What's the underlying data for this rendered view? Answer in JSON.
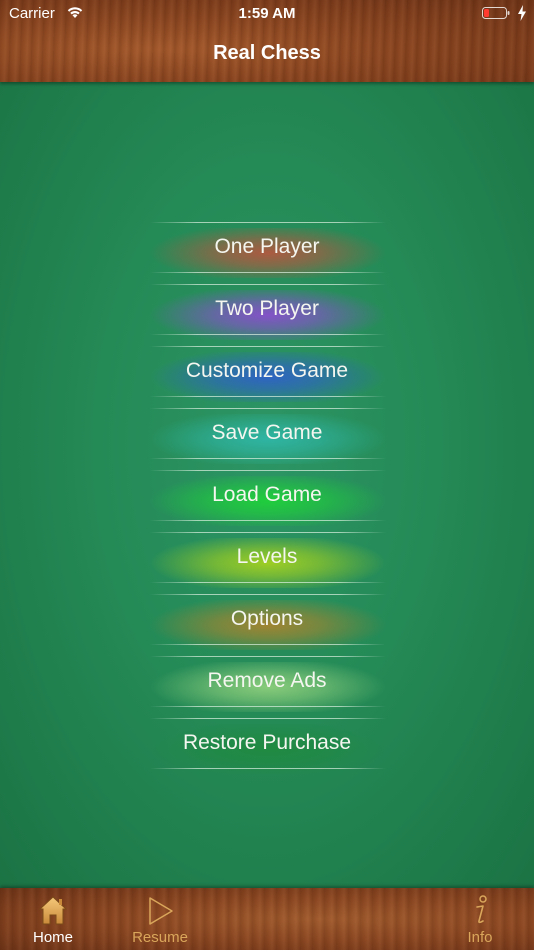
{
  "status_bar": {
    "carrier": "Carrier",
    "time": "1:59 AM",
    "icons": [
      "wifi-icon",
      "battery-low-icon",
      "charging-bolt-icon"
    ]
  },
  "header": {
    "title": "Real Chess"
  },
  "menu": {
    "items": [
      {
        "label": "One Player",
        "glow": "#b5573f"
      },
      {
        "label": "Two Player",
        "glow": "#8a4fcf"
      },
      {
        "label": "Customize Game",
        "glow": "#2f60c9"
      },
      {
        "label": "Save Game",
        "glow": "#2fb7a8"
      },
      {
        "label": "Load Game",
        "glow": "#1fd23a"
      },
      {
        "label": "Levels",
        "glow": "#a6d21f"
      },
      {
        "label": "Options",
        "glow": "#a8842f"
      },
      {
        "label": "Remove Ads",
        "glow": "#8fd07d"
      },
      {
        "label": "Restore Purchase",
        "glow": "#1f8a40"
      }
    ]
  },
  "tabbar": {
    "tabs": [
      {
        "label": "Home",
        "icon": "home-icon",
        "selected": true
      },
      {
        "label": "Resume",
        "icon": "play-icon",
        "selected": false
      },
      {
        "label": "Info",
        "icon": "info-icon",
        "selected": false
      }
    ]
  },
  "colors": {
    "felt": "#248a56",
    "wood": "#8a4520",
    "tab_inactive": "#d9a65b",
    "tab_active": "#ffffff"
  }
}
